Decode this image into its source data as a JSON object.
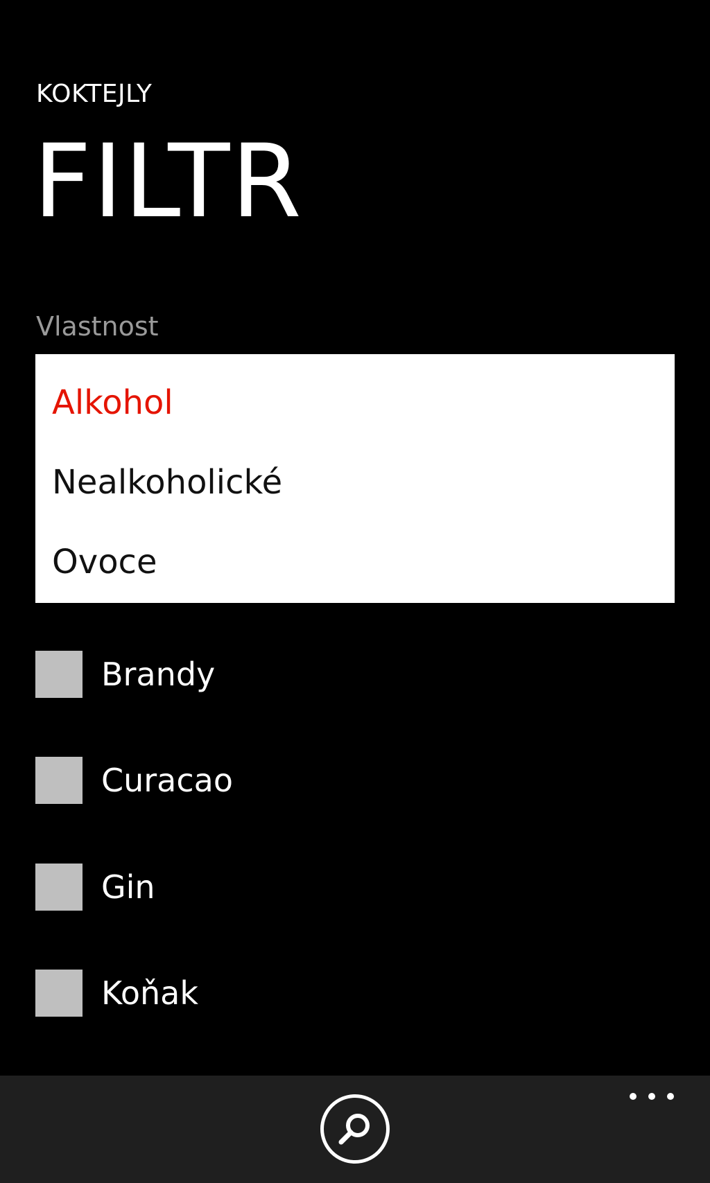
{
  "header": {
    "app_title": "KOKTEJLY",
    "page_title": "FILTR"
  },
  "filter": {
    "label": "Vlastnost",
    "options": [
      {
        "label": "Alkohol",
        "selected": true
      },
      {
        "label": "Nealkoholické",
        "selected": false
      },
      {
        "label": "Ovoce",
        "selected": false
      }
    ],
    "accent_color": "#e51400"
  },
  "checklist": {
    "items": [
      {
        "label": "Brandy",
        "checked": false
      },
      {
        "label": "Curacao",
        "checked": false
      },
      {
        "label": "Gin",
        "checked": false
      },
      {
        "label": "Koňak",
        "checked": false
      }
    ]
  },
  "app_bar": {
    "search_icon": "search-icon",
    "more_icon": "more-dots-icon"
  }
}
